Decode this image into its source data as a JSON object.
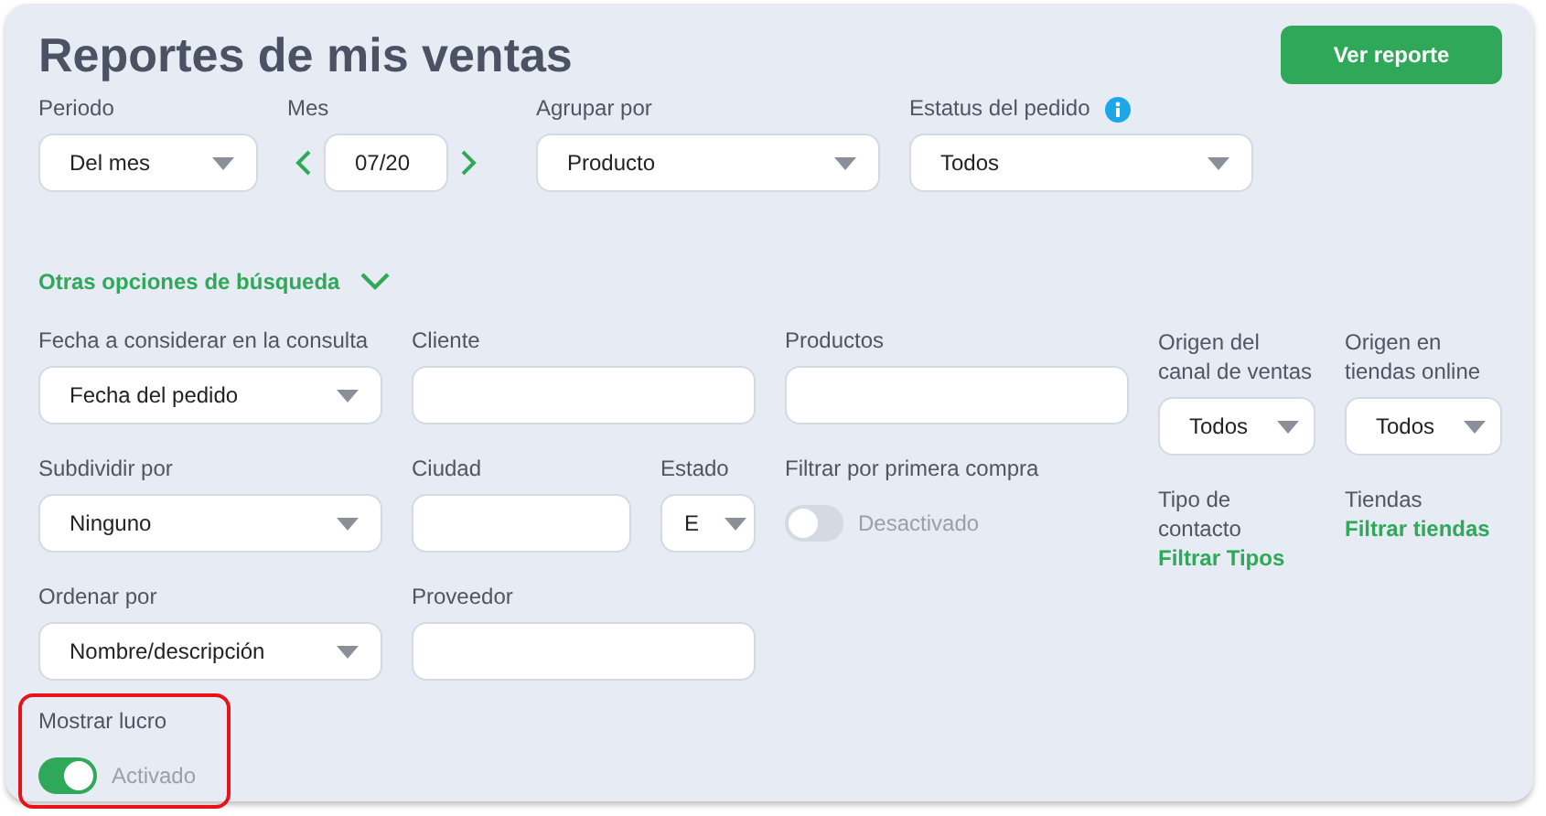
{
  "title": "Reportes de mis ventas",
  "report_button": "Ver reporte",
  "top_filters": [
    {
      "kind": "short_select",
      "label": "Periodo",
      "value": "Del mes"
    },
    {
      "kind": "month",
      "label": "Mes",
      "value": "07/20"
    },
    {
      "kind": "select",
      "label": "Agrupar por",
      "value": "Producto"
    },
    {
      "kind": "select",
      "label": "Estatus del pedido",
      "value": "Todos",
      "info": true
    }
  ],
  "more_options": {
    "label": "Otras opciones de búsqueda",
    "expanded": true
  },
  "rows": [
    [
      {
        "kind": "select",
        "label": "Fecha a considerar en la consulta",
        "value": "Fecha del pedido"
      },
      {
        "kind": "input",
        "label": "Cliente"
      },
      {
        "kind": "input",
        "label": "Productos"
      }
    ],
    [
      {
        "kind": "select",
        "label": "Subdividir por",
        "value": "Ninguno"
      },
      {
        "kind": "split",
        "city": {
          "label": "Ciudad"
        },
        "state": {
          "label": "Estado",
          "value": "E"
        }
      },
      {
        "kind": "toggle",
        "label": "Filtrar por primera compra",
        "on": false,
        "state_text": "Desactivado"
      }
    ],
    [
      {
        "kind": "select",
        "label": "Ordenar por",
        "value": "Nombre/descripción"
      },
      {
        "kind": "input",
        "label": "Proveedor"
      }
    ]
  ],
  "right_selects": [
    {
      "label": "Origen del canal de ventas",
      "value": "Todos"
    },
    {
      "label": "Origen en tiendas online",
      "value": "Todos"
    }
  ],
  "right_links": [
    {
      "label": "Tipo de contacto",
      "link": "Filtrar Tipos"
    },
    {
      "label": "Tiendas",
      "link": "Filtrar tiendas"
    }
  ],
  "profit": {
    "label": "Mostrar lucro",
    "on": true,
    "state_text": "Activado",
    "highlighted": true
  }
}
